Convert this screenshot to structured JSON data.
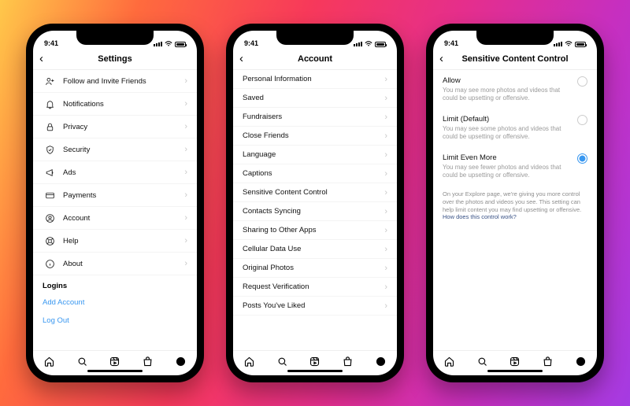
{
  "status": {
    "time": "9:41",
    "wifi": "wifi",
    "battery": "battery"
  },
  "screens": {
    "settings": {
      "title": "Settings",
      "items": [
        {
          "icon": "user-plus-icon",
          "label": "Follow and Invite Friends"
        },
        {
          "icon": "bell-icon",
          "label": "Notifications"
        },
        {
          "icon": "lock-icon",
          "label": "Privacy"
        },
        {
          "icon": "shield-icon",
          "label": "Security"
        },
        {
          "icon": "megaphone-icon",
          "label": "Ads"
        },
        {
          "icon": "card-icon",
          "label": "Payments"
        },
        {
          "icon": "person-circle-icon",
          "label": "Account"
        },
        {
          "icon": "lifebuoy-icon",
          "label": "Help"
        },
        {
          "icon": "info-icon",
          "label": "About"
        }
      ],
      "logins_header": "Logins",
      "add_account": "Add Account",
      "log_out": "Log Out"
    },
    "account": {
      "title": "Account",
      "items": [
        "Personal Information",
        "Saved",
        "Fundraisers",
        "Close Friends",
        "Language",
        "Captions",
        "Sensitive Content Control",
        "Contacts Syncing",
        "Sharing to Other Apps",
        "Cellular Data Use",
        "Original Photos",
        "Request Verification",
        "Posts You've Liked"
      ]
    },
    "scc": {
      "title": "Sensitive Content Control",
      "options": [
        {
          "label": "Allow",
          "sub": "You may see more photos and videos that could be upsetting or offensive.",
          "selected": false
        },
        {
          "label": "Limit (Default)",
          "sub": "You may see some photos and videos that could be upsetting or offensive.",
          "selected": false
        },
        {
          "label": "Limit Even More",
          "sub": "You may see fewer photos and videos that could be upsetting or offensive.",
          "selected": true
        }
      ],
      "info_text": "On your Explore page, we're giving you more control over the photos and videos you see. This setting can help limit content you may find upsetting or offensive. ",
      "info_link": "How does this control work?"
    }
  }
}
